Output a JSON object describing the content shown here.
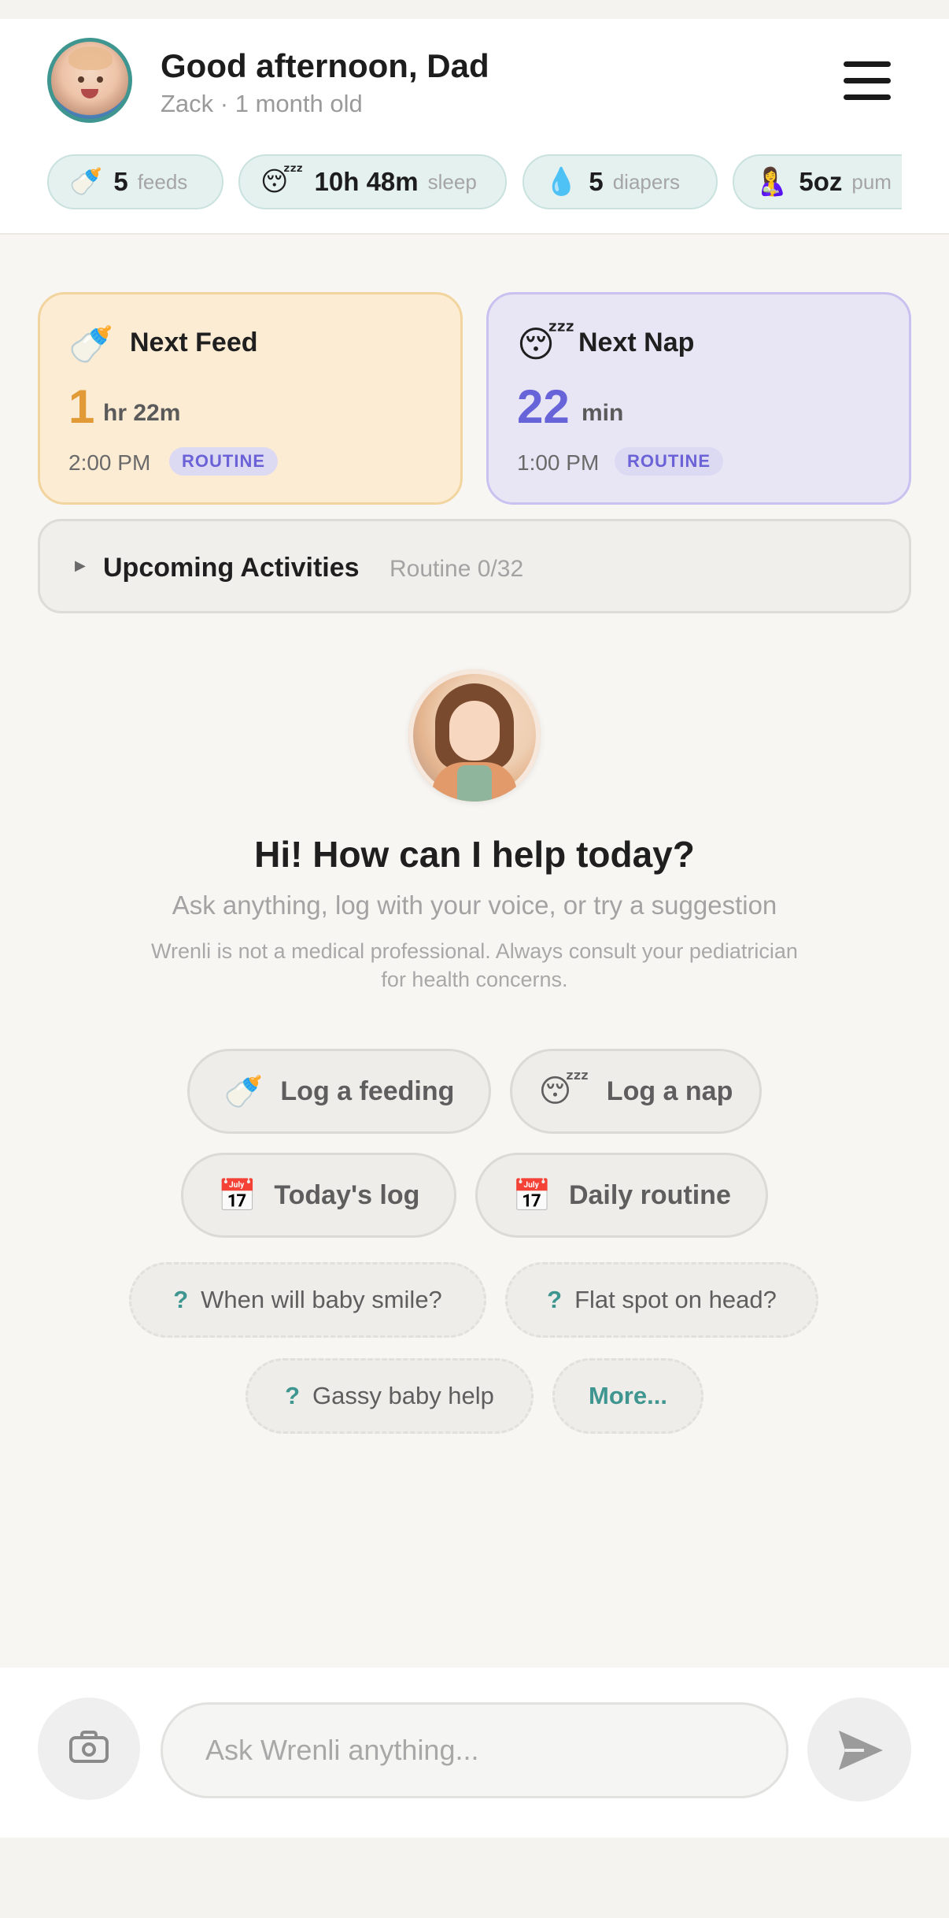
{
  "header": {
    "greeting": "Good afternoon, Dad",
    "baby_info": "Zack · 1 month old"
  },
  "stats": [
    {
      "icon": "baby-bottle-icon",
      "glyph": "🍼",
      "value": "5",
      "label": "feeds"
    },
    {
      "icon": "sleeping-face-icon",
      "glyph": "😴",
      "value": "10h 48m",
      "label": "sleep"
    },
    {
      "icon": "droplet-icon",
      "glyph": "💧",
      "value": "5",
      "label": "diapers"
    },
    {
      "icon": "breastfeeding-icon",
      "glyph": "🤱",
      "value": "5oz",
      "label": "pum"
    }
  ],
  "next_feed": {
    "glyph": "🍼",
    "title": "Next Feed",
    "value": "1",
    "unit": "hr 22m",
    "time": "2:00 PM",
    "badge": "ROUTINE"
  },
  "next_nap": {
    "glyph": "😴",
    "title": "Next Nap",
    "value": "22",
    "unit": "min",
    "time": "1:00 PM",
    "badge": "ROUTINE"
  },
  "upcoming": {
    "title": "Upcoming Activities",
    "subtitle": "Routine 0/32"
  },
  "assistant": {
    "title": "Hi! How can I help today?",
    "subtitle": "Ask anything, log with your voice, or try a suggestion",
    "disclaimer": "Wrenli is not a medical professional. Always consult your pediatrician for health concerns."
  },
  "actions": [
    {
      "glyph": "🍼",
      "label": "Log a feeding"
    },
    {
      "glyph": "😴",
      "label": "Log a nap"
    },
    {
      "glyph": "📅",
      "label": "Today's log"
    },
    {
      "glyph": "📅",
      "label": "Daily routine"
    }
  ],
  "questions": [
    {
      "mark": "?",
      "label": "When will baby smile?"
    },
    {
      "mark": "?",
      "label": "Flat spot on head?"
    },
    {
      "mark": "?",
      "label": "Gassy baby help"
    }
  ],
  "more_label": "More...",
  "composer": {
    "placeholder": "Ask Wrenli anything..."
  },
  "colors": {
    "accent_teal": "#3f9690",
    "feed_orange": "#e19a36",
    "nap_purple": "#6763d8"
  }
}
